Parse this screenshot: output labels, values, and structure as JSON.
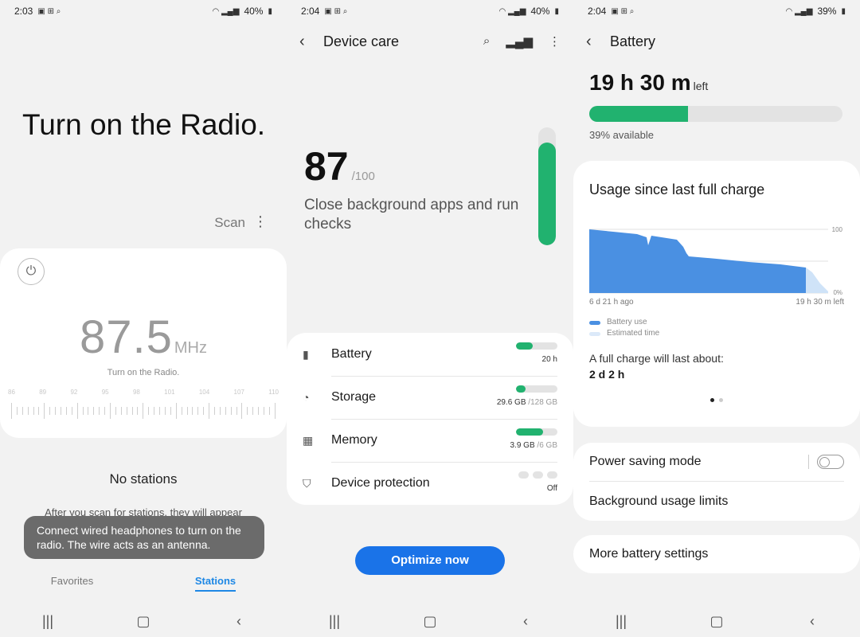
{
  "radio": {
    "status": {
      "time": "2:03",
      "battery": "40%"
    },
    "title": "Turn on the Radio.",
    "scan_label": "Scan",
    "frequency": "87.5",
    "unit": "MHz",
    "subtitle": "Turn on the Radio.",
    "scale_labels": [
      "86",
      "89",
      "92",
      "95",
      "98",
      "101",
      "104",
      "107",
      "110"
    ],
    "no_stations": "No stations",
    "stations_hint": "After you scan for stations, they will appear",
    "toast": "Connect wired headphones to turn on the radio. The wire acts as an antenna.",
    "tabs": [
      "Favorites",
      "Stations"
    ],
    "active_tab": "Stations"
  },
  "device_care": {
    "status": {
      "time": "2:04",
      "battery": "40%"
    },
    "title": "Device care",
    "score": "87",
    "score_max": "/100",
    "score_fraction": 0.87,
    "message": "Close background apps and run checks",
    "items": [
      {
        "label": "Battery",
        "value": "20 h",
        "value_dim": "",
        "fill": 0.4
      },
      {
        "label": "Storage",
        "value": "29.6 GB",
        "value_dim": "/128 GB",
        "fill": 0.23
      },
      {
        "label": "Memory",
        "value": "3.9 GB",
        "value_dim": "/6 GB",
        "fill": 0.65
      },
      {
        "label": "Device protection",
        "value": "Off",
        "value_dim": "",
        "fill": 0
      }
    ],
    "optimize_label": "Optimize now"
  },
  "battery": {
    "status": {
      "time": "2:04",
      "battery": "39%"
    },
    "title": "Battery",
    "time_left": "19 h 30 m",
    "time_left_suffix": "left",
    "level_fraction": 0.39,
    "available": "39% available",
    "usage_title": "Usage since last full charge",
    "chart_start": "6 d 21 h ago",
    "chart_end": "19 h 30 m left",
    "y_top": "100",
    "y_bottom": "0%",
    "legend": [
      "Battery use",
      "Estimated time"
    ],
    "full_charge_label": "A full charge will last about:",
    "full_charge_value": "2 d 2 h",
    "power_saving": "Power saving mode",
    "bg_limits": "Background usage limits",
    "more_settings": "More battery settings"
  },
  "colors": {
    "accent_green": "#21b26f",
    "accent_blue": "#1a73e8",
    "chart_blue": "#4a90e2"
  }
}
